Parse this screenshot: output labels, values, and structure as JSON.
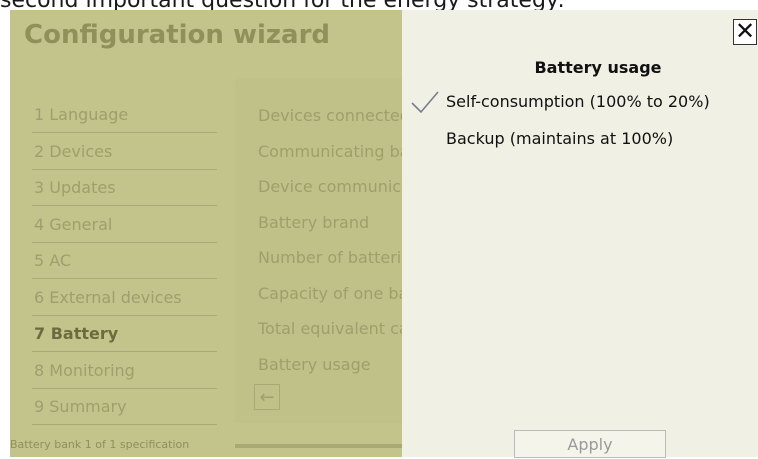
{
  "caption": "second important question for the energy strategy:",
  "wizard": {
    "title": "Configuration wizard",
    "steps": [
      {
        "label": "1 Language"
      },
      {
        "label": "2 Devices"
      },
      {
        "label": "3 Updates"
      },
      {
        "label": "4 General"
      },
      {
        "label": "5 AC"
      },
      {
        "label": "6 External devices"
      },
      {
        "label": "7 Battery",
        "active": true
      },
      {
        "label": "8 Monitoring"
      },
      {
        "label": "9 Summary"
      }
    ],
    "rows": [
      "Devices connected",
      "Communicating battery",
      "Device communication",
      "Battery brand",
      "Number of batteries",
      "Capacity of one battery",
      "Total equivalent capacity",
      "Battery usage"
    ],
    "back_icon": "arrow-left-icon",
    "footer": "Battery bank 1 of 1 specification"
  },
  "drawer": {
    "title": "Battery usage",
    "options": [
      {
        "label": "Self-consumption (100% to 20%)",
        "selected": true
      },
      {
        "label": "Backup (maintains at 100%)",
        "selected": false
      }
    ],
    "close_icon": "close-icon",
    "apply_label": "Apply"
  },
  "colors": {
    "overlay": "#c3c48c",
    "drawer_bg": "#f0f0e4",
    "check": "#7a7e8a"
  }
}
